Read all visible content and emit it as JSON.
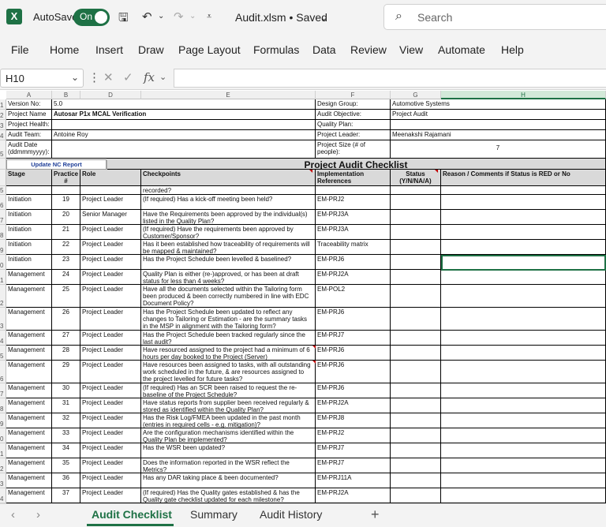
{
  "titlebar": {
    "autosave_label": "AutoSave",
    "autosave_state": "On",
    "filename": "Audit.xlsm • Saved",
    "search_placeholder": "Search"
  },
  "menu": [
    "File",
    "Home",
    "Insert",
    "Draw",
    "Page Layout",
    "Formulas",
    "Data",
    "Review",
    "View",
    "Automate",
    "Help"
  ],
  "formula_bar": {
    "name_box": "H10",
    "formula": ""
  },
  "columns": [
    "A",
    "B",
    "D",
    "E",
    "F",
    "G",
    "H"
  ],
  "selected_column": "H",
  "selected_cell": "H10",
  "header_block": {
    "left": [
      {
        "label": "Version No:",
        "value": "5.0"
      },
      {
        "label": "Project Name",
        "value": "Autosar P1x MCAL Verification"
      },
      {
        "label": "Project Health:",
        "value": ""
      },
      {
        "label": "Audit Team:",
        "value": "Antoine Roy"
      },
      {
        "label": "Audit Date (ddmmmyyyy):",
        "value": ""
      }
    ],
    "right": [
      {
        "label": "Design Group:",
        "value": "Automotive Systems"
      },
      {
        "label": "Audit Objective:",
        "value": "Project Audit"
      },
      {
        "label": "Quality Plan:",
        "value": ""
      },
      {
        "label": "Project Leader:",
        "value": "Meenakshi Rajamani"
      },
      {
        "label": "Project Size (# of people):",
        "value": "7"
      }
    ]
  },
  "row_numbers_header": [
    "1",
    "2",
    "3",
    "4",
    "5"
  ],
  "nc_button": "Update NC Report",
  "checklist_title": "Project Audit Checklist",
  "table_headers": {
    "stage": "Stage",
    "practice": "Practice #",
    "role": "Role",
    "checkpoints": "Checkpoints",
    "impl_ref": "Implementation References",
    "status": "Status (Y/N/NA/A)",
    "reason": "Reason / Comments if Status is RED or No"
  },
  "partial_row": {
    "row": "5",
    "checkpoint": "recorded?"
  },
  "rows": [
    {
      "row": "6",
      "stage": "Initiation",
      "practice": "19",
      "role": "Project Leader",
      "checkpoint": "(If required) Has a kick-off meeting been held?",
      "ref": "EM-PRJ2"
    },
    {
      "row": "7",
      "stage": "Initiation",
      "practice": "20",
      "role": "Senior Manager",
      "checkpoint": "Have the Requirements been approved by the individual(s) listed in the Quality Plan?",
      "ref": "EM-PRJ3A"
    },
    {
      "row": "8",
      "stage": "Initiation",
      "practice": "21",
      "role": "Project Leader",
      "checkpoint": "(If required) Have the requirements been approved by Customer/Sponsor?",
      "ref": "EM-PRJ3A"
    },
    {
      "row": "9",
      "stage": "Initiation",
      "practice": "22",
      "role": "Project Leader",
      "checkpoint": "Has it been established how traceability of requirements will be mapped & maintained?",
      "ref": "Traceability matrix"
    },
    {
      "row": "0",
      "stage": "Initiation",
      "practice": "23",
      "role": "Project Leader",
      "checkpoint": "Has the Project Schedule been levelled & baselined?",
      "ref": "EM-PRJ6"
    },
    {
      "row": "1",
      "stage": "Management",
      "practice": "24",
      "role": "Project Leader",
      "checkpoint": "Quality Plan is either (re-)approved, or has been at draft status for less than 4 weeks?",
      "ref": "EM-PRJ2A"
    },
    {
      "row": "2",
      "stage": "Management",
      "practice": "25",
      "role": "Project Leader",
      "checkpoint": "Have all the documents selected within the Tailoring form been produced & been correctly numbered in line with EDC Document Policy?",
      "ref": "EM-POL2"
    },
    {
      "row": "3",
      "stage": "Management",
      "practice": "26",
      "role": "Project Leader",
      "checkpoint": "Has the Project Schedule been updated to reflect any changes to Tailoring or Estimation - are the summary tasks in the MSP in alignment with the Tailoring form?",
      "ref": "EM-PRJ6"
    },
    {
      "row": "4",
      "stage": "Management",
      "practice": "27",
      "role": "Project Leader",
      "checkpoint": "Has the Project Schedule been tracked regularly since the last audit?",
      "ref": "EM-PRJ7"
    },
    {
      "row": "5",
      "stage": "Management",
      "practice": "28",
      "role": "Project Leader",
      "checkpoint": "Have resourced assigned to the project had a minimum of 6 hours per day booked to the Project (Server)",
      "ref": "EM-PRJ6"
    },
    {
      "row": "6",
      "stage": "Management",
      "practice": "29",
      "role": "Project Leader",
      "checkpoint": "Have resources been assigned to tasks, with all outstanding work scheduled in the future, & are resources assigned to the project levelled for future tasks?",
      "ref": "EM-PRJ6"
    },
    {
      "row": "7",
      "stage": "Management",
      "practice": "30",
      "role": "Project Leader",
      "checkpoint": "(If required) Has an SCR been raised to request the re-baseline of the Project Schedule?",
      "ref": "EM-PRJ6"
    },
    {
      "row": "8",
      "stage": "Management",
      "practice": "31",
      "role": "Project Leader",
      "checkpoint": "Have status reports from supplier been received regularly & stored as identified within the Quality Plan?",
      "ref": "EM-PRJ2A"
    },
    {
      "row": "9",
      "stage": "Management",
      "practice": "32",
      "role": "Project Leader",
      "checkpoint": "Has the Risk Log/FMEA been updated in the past month (entries in required cells - e.g. mitigation)?",
      "ref": "EM-PRJ8"
    },
    {
      "row": "0",
      "stage": "Management",
      "practice": "33",
      "role": "Project Leader",
      "checkpoint": "Are the configuration mechanisms identified within the Quality Plan be implemented?",
      "ref": "EM-PRJ2"
    },
    {
      "row": "1",
      "stage": "Management",
      "practice": "34",
      "role": "Project Leader",
      "checkpoint": "Has the WSR been updated?",
      "ref": "EM-PRJ7"
    },
    {
      "row": "2",
      "stage": "Management",
      "practice": "35",
      "role": "Project Leader",
      "checkpoint": "Does the information reported in the WSR reflect the Metrics?",
      "ref": "EM-PRJ7"
    },
    {
      "row": "3",
      "stage": "Management",
      "practice": "36",
      "role": "Project Leader",
      "checkpoint": "Has any DAR taking place & been documented?",
      "ref": "EM-PRJ11A"
    },
    {
      "row": "4",
      "stage": "Management",
      "practice": "37",
      "role": "Project Leader",
      "checkpoint": "(If required) Has the Quality gates established & has the Quality gate checklist updated for each milestone?",
      "ref": "EM-PRJ2A"
    }
  ],
  "sheets": [
    "Audit Checklist",
    "Summary",
    "Audit History"
  ],
  "active_sheet": "Audit Checklist",
  "colors": {
    "accent": "#1e7145",
    "header_gray": "#d9d9d9",
    "button_text": "#1f3f99",
    "comment_marker": "#c00000"
  }
}
